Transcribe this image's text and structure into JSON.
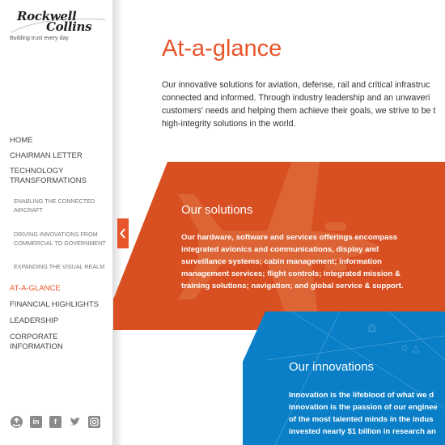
{
  "logo": {
    "line1": "Rockwell",
    "line2": "Collins",
    "tagline": "Building trust every day"
  },
  "nav": {
    "items": [
      {
        "label": "HOME"
      },
      {
        "label": "CHAIRMAN LETTER"
      },
      {
        "label": "TECHNOLOGY TRANSFORMATIONS"
      },
      {
        "label": "AT-A-GLANCE"
      },
      {
        "label": "FINANCIAL HIGHLIGHTS"
      },
      {
        "label": "LEADERSHIP"
      },
      {
        "label": "CORPORATE INFORMATION"
      }
    ],
    "tech_line1": "TECHNOLOGY",
    "tech_line2": "TRANSFORMATIONS",
    "sub": {
      "enabling_1": "ENABLING THE CONNECTED",
      "enabling_2": "AIRCRAFT",
      "driving_1": "DRIVING INNOVATIONS FROM",
      "driving_2": "COMMERCIAL TO GOVERNMENT",
      "expanding": "EXPANDING THE VISUAL REALM"
    }
  },
  "social": [
    "share-icon",
    "linkedin-icon",
    "facebook-icon",
    "twitter-icon",
    "instagram-icon"
  ],
  "page": {
    "title": "At-a-glance",
    "intro": [
      "Our innovative solutions for aviation, defense, rail and critical infrastruc",
      "connected and informed. Through industry leadership and an unwaveri",
      "customers' needs and helping them achieve their goals, we strive to be t",
      "high-integrity solutions in the world."
    ]
  },
  "solutions": {
    "title": "Our solutions",
    "body": [
      "Our hardware, software and services offerings encompass",
      "integrated avionics and communications, display and",
      "surveillance systems; cabin management; information",
      "management services; flight controls; integrated mission &",
      "training solutions; navigation; and global service & support."
    ]
  },
  "innovations": {
    "title": "Our innovations",
    "body": [
      "Innovation is the lifeblood of what we d",
      "innovation is the passion of our enginee",
      "of the most talented minds in the indus",
      "invested nearly $1 billion in research an"
    ]
  },
  "colors": {
    "accent": "#e8552b",
    "orange_panel": "#d84f22",
    "blue_panel": "#0a7fc7"
  }
}
